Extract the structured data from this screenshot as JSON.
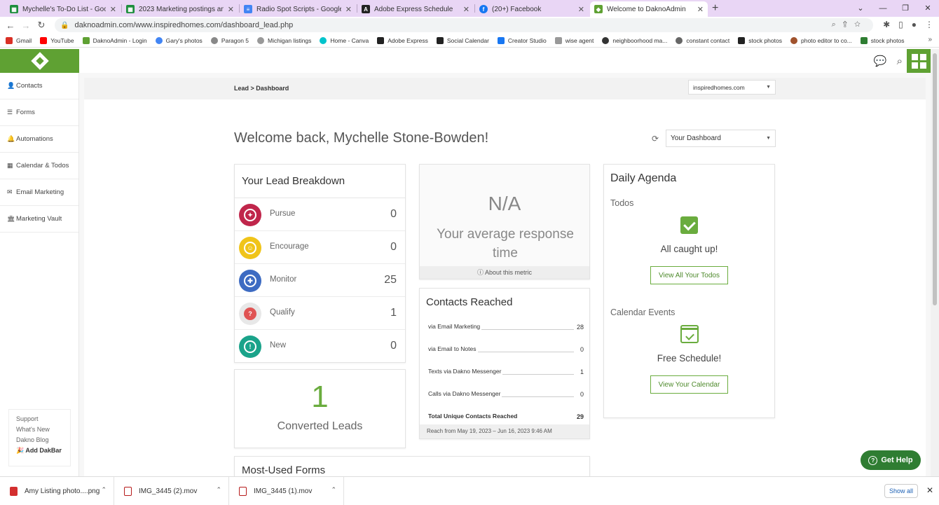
{
  "browser": {
    "tabs": [
      {
        "title": "Mychelle's To-Do List - Google S",
        "icon": "sheets-icon",
        "color": "#1e8e3e"
      },
      {
        "title": "2023 Marketing postings and pro",
        "icon": "sheets-icon",
        "color": "#1e8e3e"
      },
      {
        "title": "Radio Spot Scripts - Google Docs",
        "icon": "docs-icon",
        "color": "#4285f4"
      },
      {
        "title": "Adobe Express Schedule",
        "icon": "adobe-icon",
        "color": "#222222"
      },
      {
        "title": "(20+) Facebook",
        "icon": "facebook-icon",
        "color": "#1877f2"
      },
      {
        "title": "Welcome to DaknoAdmin",
        "icon": "dakno-icon",
        "color": "#5fa133"
      }
    ],
    "url": "daknoadmin.com/www.inspiredhomes.com/dashboard_lead.php",
    "bookmarks": [
      {
        "label": "Gmail",
        "color": "#d93025"
      },
      {
        "label": "YouTube",
        "color": "#ff0000"
      },
      {
        "label": "DaknoAdmin - Login",
        "color": "#5fa133"
      },
      {
        "label": "Gary's photos",
        "color": "#4285f4"
      },
      {
        "label": "Paragon 5",
        "color": "#555555"
      },
      {
        "label": "Michigan listings",
        "color": "#666666"
      },
      {
        "label": "Home - Canva",
        "color": "#00c4cc"
      },
      {
        "label": "Adobe Express",
        "color": "#222222"
      },
      {
        "label": "Social Calendar",
        "color": "#222222"
      },
      {
        "label": "Creator Studio",
        "color": "#1877f2"
      },
      {
        "label": "wise agent",
        "color": "#777777"
      },
      {
        "label": "neighboorhood ma...",
        "color": "#333333"
      },
      {
        "label": "constant contact",
        "color": "#555555"
      },
      {
        "label": "stock photos",
        "color": "#222222"
      },
      {
        "label": "photo editor to co...",
        "color": "#a0522d"
      },
      {
        "label": "stock photos",
        "color": "#2e7d32"
      }
    ]
  },
  "sidebar": {
    "items": [
      {
        "label": "Contacts",
        "icon": "user-icon"
      },
      {
        "label": "Forms",
        "icon": "list-icon"
      },
      {
        "label": "Automations",
        "icon": "bell-icon"
      },
      {
        "label": "Calendar & Todos",
        "icon": "calendar-icon"
      },
      {
        "label": "Email Marketing",
        "icon": "envelope-icon"
      },
      {
        "label": "Marketing Vault",
        "icon": "bank-icon"
      }
    ],
    "footer": {
      "support": "Support",
      "whats_new": "What's New",
      "blog": "Dakno Blog",
      "dakbar": "Add DakBar"
    }
  },
  "main": {
    "breadcrumb": "Lead > Dashboard",
    "site_select": "inspiredhomes.com",
    "welcome": "Welcome back, Mychelle Stone-Bowden!",
    "dashboard_select": "Your Dashboard",
    "lead_breakdown": {
      "title": "Your Lead Breakdown",
      "rows": [
        {
          "label": "Pursue",
          "count": "0",
          "color": "#c0264b",
          "glyph": "✦"
        },
        {
          "label": "Encourage",
          "count": "0",
          "color": "#f0c419",
          "glyph": "☺"
        },
        {
          "label": "Monitor",
          "count": "25",
          "color": "#3d6bc2",
          "glyph": "✚"
        },
        {
          "label": "Qualify",
          "count": "1",
          "color": "#e05454",
          "glyph": "?"
        },
        {
          "label": "New",
          "count": "0",
          "color": "#1aa38a",
          "glyph": "!"
        }
      ]
    },
    "converted": {
      "value": "1",
      "label": "Converted Leads"
    },
    "response": {
      "value": "N/A",
      "label": "Your average response time",
      "footer": "About this metric"
    },
    "contacts_reached": {
      "title": "Contacts Reached",
      "rows": [
        {
          "label": "via Email Marketing",
          "value": "28"
        },
        {
          "label": "via Email to Notes",
          "value": "0"
        },
        {
          "label": "Texts via Dakno Messenger",
          "value": "1"
        },
        {
          "label": "Calls via Dakno Messenger",
          "value": "0"
        },
        {
          "label": "Total Unique Contacts Reached",
          "value": "29"
        }
      ],
      "footer": "Reach from May 19, 2023 – Jun 16, 2023 9:46 AM"
    },
    "forms": {
      "title": "Most-Used Forms"
    },
    "agenda": {
      "title": "Daily Agenda",
      "todos_label": "Todos",
      "todos_msg": "All caught up!",
      "todos_btn": "View All Your Todos",
      "events_label": "Calendar Events",
      "events_msg": "Free Schedule!",
      "events_btn": "View Your Calendar"
    },
    "get_help": "Get Help"
  },
  "downloads": {
    "items": [
      {
        "name": "Amy Listing photo....png",
        "color": "#d32f2f"
      },
      {
        "name": "IMG_3445 (2).mov",
        "color": "#b71c1c"
      },
      {
        "name": "IMG_3445 (1).mov",
        "color": "#b71c1c"
      }
    ],
    "show_all": "Show all"
  }
}
